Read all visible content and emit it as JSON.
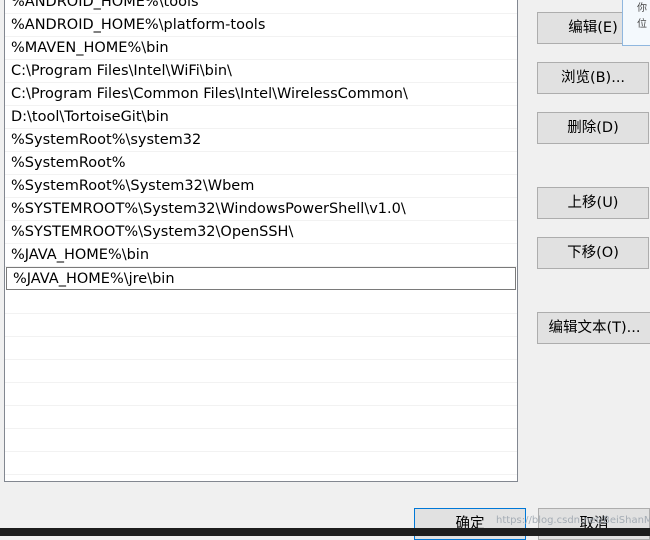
{
  "list": {
    "items": [
      "%ANDROID_HOME%\\tools",
      "%ANDROID_HOME%\\platform-tools",
      "%MAVEN_HOME%\\bin",
      "C:\\Program Files\\Intel\\WiFi\\bin\\",
      "C:\\Program Files\\Common Files\\Intel\\WirelessCommon\\",
      "D:\\tool\\TortoiseGit\\bin",
      "%SystemRoot%\\system32",
      "%SystemRoot%",
      "%SystemRoot%\\System32\\Wbem",
      "%SYSTEMROOT%\\System32\\WindowsPowerShell\\v1.0\\",
      "%SYSTEMROOT%\\System32\\OpenSSH\\",
      "%JAVA_HOME%\\bin",
      "%JAVA_HOME%\\jre\\bin"
    ],
    "selected_index": 12
  },
  "buttons": {
    "edit": "编辑(E)",
    "browse": "浏览(B)...",
    "delete": "删除(D)",
    "move_up": "上移(U)",
    "move_down": "下移(O)",
    "edit_text": "编辑文本(T)..."
  },
  "footer": {
    "ok": "确定",
    "cancel": "取消"
  },
  "tooltip": {
    "line1": "你",
    "line2": "位"
  },
  "watermark": "https://blog.csdn.net/BeiShanMan"
}
